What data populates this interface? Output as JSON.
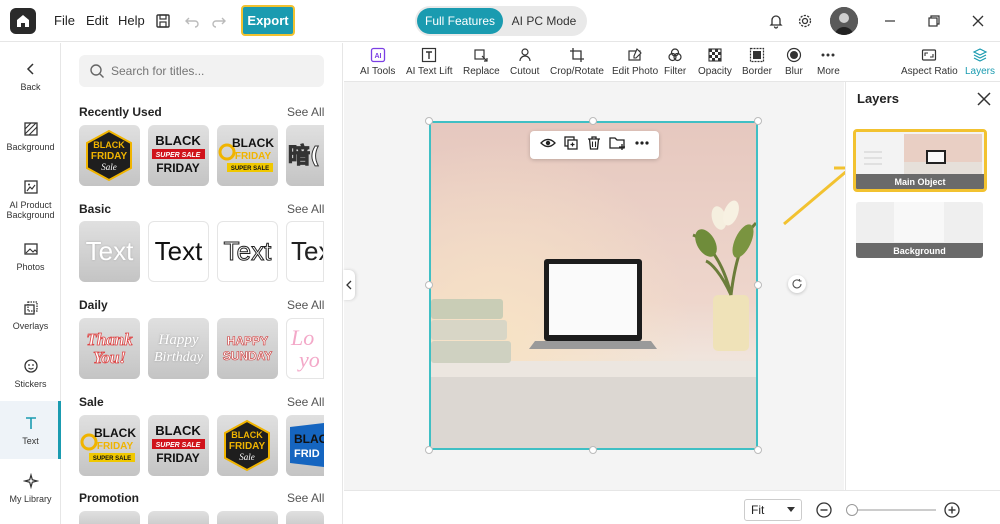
{
  "menu": {
    "file": "File",
    "edit": "Edit",
    "help": "Help"
  },
  "export_label": "Export",
  "modes": {
    "full": "Full Features",
    "ai": "AI PC Mode"
  },
  "sidebar": {
    "items": [
      {
        "label": "Back"
      },
      {
        "label": "Background"
      },
      {
        "label": "AI Product Background"
      },
      {
        "label": "Photos"
      },
      {
        "label": "Overlays"
      },
      {
        "label": "Stickers"
      },
      {
        "label": "Text"
      },
      {
        "label": "My Library"
      }
    ]
  },
  "search": {
    "placeholder": "Search for titles..."
  },
  "sections": {
    "recent": {
      "title": "Recently Used",
      "see_all": "See All"
    },
    "basic": {
      "title": "Basic",
      "see_all": "See All"
    },
    "daily": {
      "title": "Daily",
      "see_all": "See All"
    },
    "sale": {
      "title": "Sale",
      "see_all": "See All"
    },
    "promotion": {
      "title": "Promotion",
      "see_all": "See All"
    }
  },
  "thumbs": {
    "black": "BLACK",
    "friday": "FRIDAY",
    "sale": "Sale",
    "super_sale": "SUPER SALE",
    "text": "Text",
    "tex": "Tex",
    "thank": "Thank",
    "you": "You!",
    "happy": "Happy",
    "birthday": "Birthday",
    "happy_caps": "HAPPY",
    "sunday": "SUNDAY",
    "lo": "Lo",
    "yo": "yo",
    "blac": "BLAC",
    "frid": "FRID"
  },
  "tools": {
    "ai_tools": "AI Tools",
    "ai_text_lift": "AI Text Lift",
    "replace": "Replace",
    "cutout": "Cutout",
    "crop_rotate": "Crop/Rotate",
    "edit_photo": "Edit Photo",
    "filter": "Filter",
    "opacity": "Opacity",
    "border": "Border",
    "blur": "Blur",
    "more": "More",
    "aspect_ratio": "Aspect Ratio",
    "layers": "Layers"
  },
  "layers_panel": {
    "title": "Layers",
    "items": [
      {
        "label": "Main Object"
      },
      {
        "label": "Background"
      }
    ]
  },
  "zoom": {
    "selected": "Fit"
  },
  "colors": {
    "accent": "#1a9bb0",
    "highlight": "#f2c230"
  }
}
